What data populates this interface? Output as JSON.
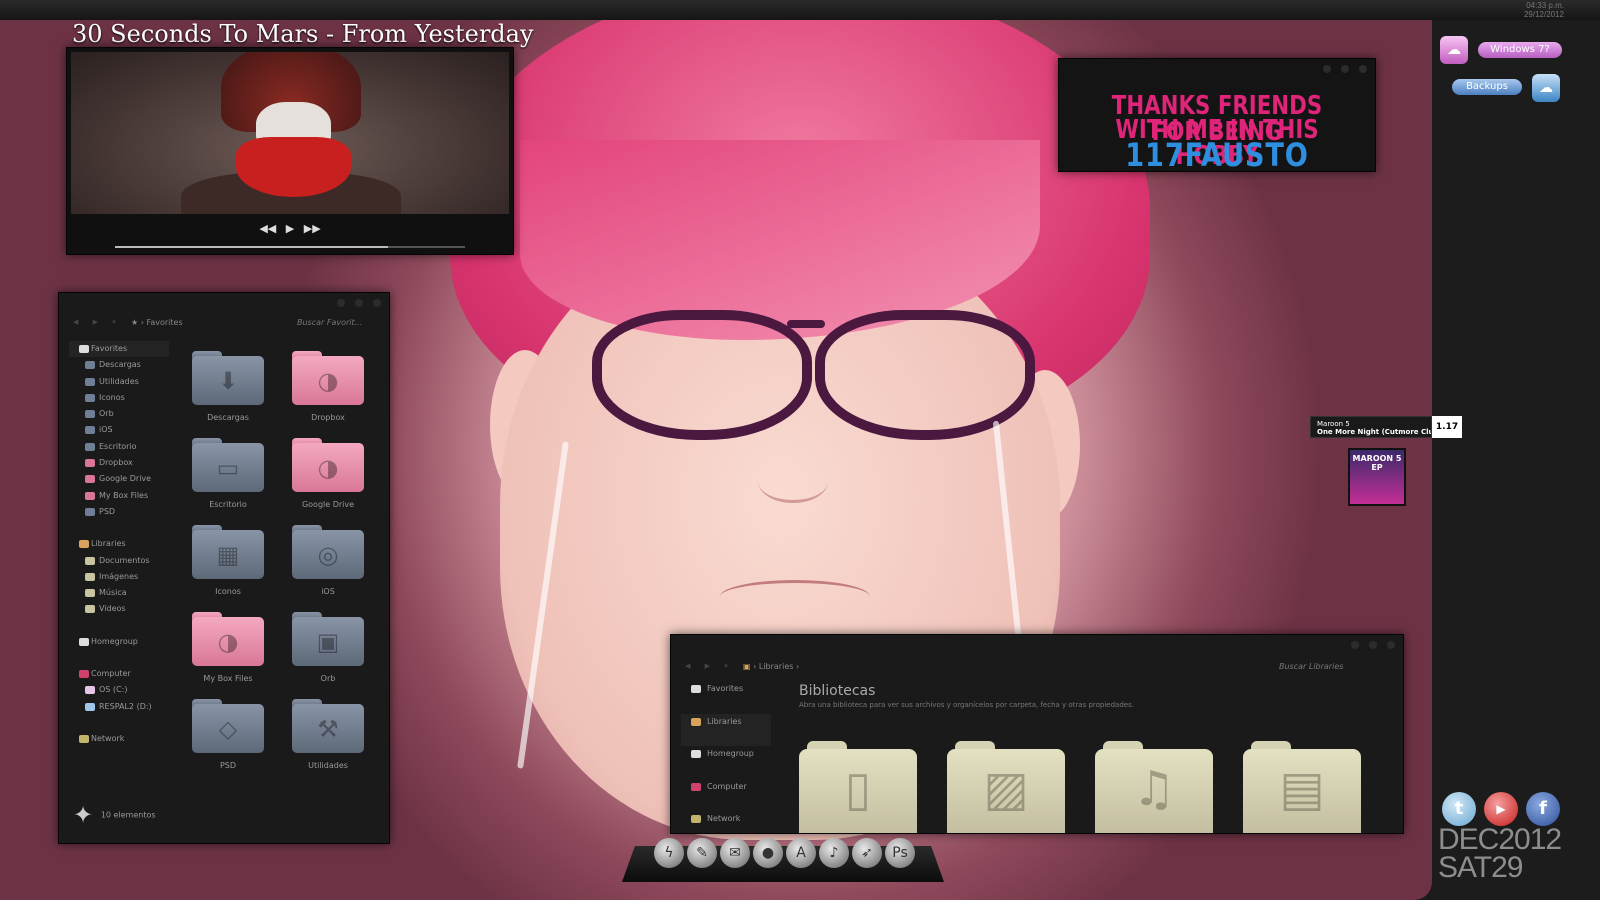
{
  "system_clock": {
    "time": "04:33 p.m.",
    "date": "29/12/2012"
  },
  "media_player": {
    "title": "30 Seconds To Mars - From Yesterday",
    "controls": {
      "prev": "◀◀",
      "play": "▶",
      "next": "▶▶"
    },
    "progress": 0.78
  },
  "banner": {
    "line1": "THANKS FRIENDS FOR BEING",
    "line2": "WITH ME IN THIS HOBBY",
    "line3": "117FAUSTO",
    "colors": {
      "text": "#e0247a",
      "name": "#2e8fe0"
    }
  },
  "explorer_favorites": {
    "address_path": "Favorites",
    "search_placeholder": "Buscar Favorit...",
    "sidebar": {
      "favorites_label": "Favorites",
      "favorites_items": [
        "Descargas",
        "Utilidades",
        "Iconos",
        "Orb",
        "iOS",
        "Escritorio",
        "Dropbox",
        "Google Drive",
        "My Box Files",
        "PSD"
      ],
      "libraries_label": "Libraries",
      "libraries_items": [
        "Documentos",
        "Imágenes",
        "Música",
        "Videos"
      ],
      "homegroup_label": "Homegroup",
      "computer_label": "Computer",
      "computer_items": [
        "OS (C:)",
        "RESPAL2 (D:)"
      ],
      "network_label": "Network"
    },
    "folders": [
      {
        "label": "Descargas",
        "color": "grey",
        "icon": "download-icon"
      },
      {
        "label": "Dropbox",
        "color": "pink",
        "icon": "swirl-icon"
      },
      {
        "label": "Escritorio",
        "color": "grey",
        "icon": "monitor-icon"
      },
      {
        "label": "Google Drive",
        "color": "pink",
        "icon": "swirl-icon"
      },
      {
        "label": "Iconos",
        "color": "grey",
        "icon": "grid-icon"
      },
      {
        "label": "iOS",
        "color": "grey",
        "icon": "ipod-icon"
      },
      {
        "label": "My Box Files",
        "color": "pink",
        "icon": "swirl-icon"
      },
      {
        "label": "Orb",
        "color": "grey",
        "icon": "floppy-icon"
      },
      {
        "label": "PSD",
        "color": "grey",
        "icon": "tag-icon"
      },
      {
        "label": "Utilidades",
        "color": "grey",
        "icon": "hammer-icon"
      }
    ],
    "status": "10 elementos"
  },
  "explorer_libraries": {
    "address_path": "Libraries",
    "search_placeholder": "Buscar Libraries",
    "sidebar": [
      "Favorites",
      "Libraries",
      "Homegroup",
      "Computer",
      "Network"
    ],
    "title": "Bibliotecas",
    "description": "Abra una biblioteca para ver sus archivos y organícelos por carpeta, fecha y otras propiedades."
  },
  "right_panel": {
    "windows_button": "Windows 7?",
    "backups_button": "Backups"
  },
  "now_playing": {
    "artist": "Maroon 5",
    "track": "One More Night (Cutmore Club",
    "number": "1.17",
    "album_text": "MAROON 5 EP"
  },
  "date_widget": {
    "line1": "DEC2012",
    "line2": "SAT29"
  }
}
